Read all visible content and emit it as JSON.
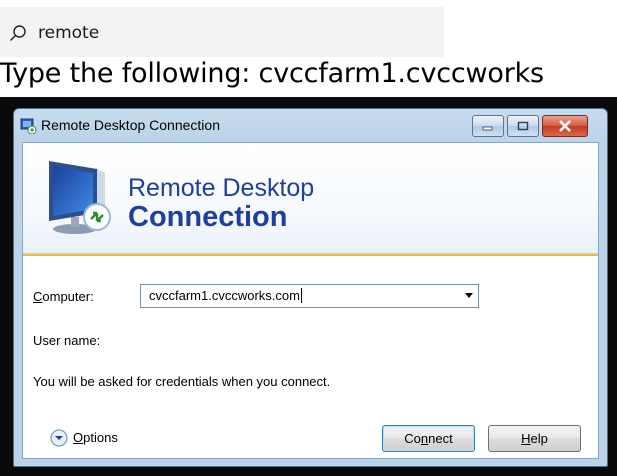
{
  "search": {
    "query": "remote",
    "icon": "search-icon"
  },
  "instruction": "Type the following: cvccfarm1.cvccworks",
  "window": {
    "title": "Remote Desktop Connection",
    "banner_line1": "Remote Desktop",
    "banner_line2": "Connection",
    "computer_label_first": "C",
    "computer_label_rest": "omputer:",
    "computer_value": "cvccfarm1.cvccworks.com",
    "username_label": "User name:",
    "credentials_note": "You will be asked for credentials when you connect.",
    "options_first": "O",
    "options_rest": "ptions",
    "connect_pre": "Co",
    "connect_ul": "n",
    "connect_post": "nect",
    "help_first": "H",
    "help_rest": "elp",
    "colors": {
      "banner_text": "#1f3f9a",
      "title_frame": "#bcd3ea",
      "close_button": "#c03c20",
      "accent_bar": "#e8b033"
    }
  }
}
